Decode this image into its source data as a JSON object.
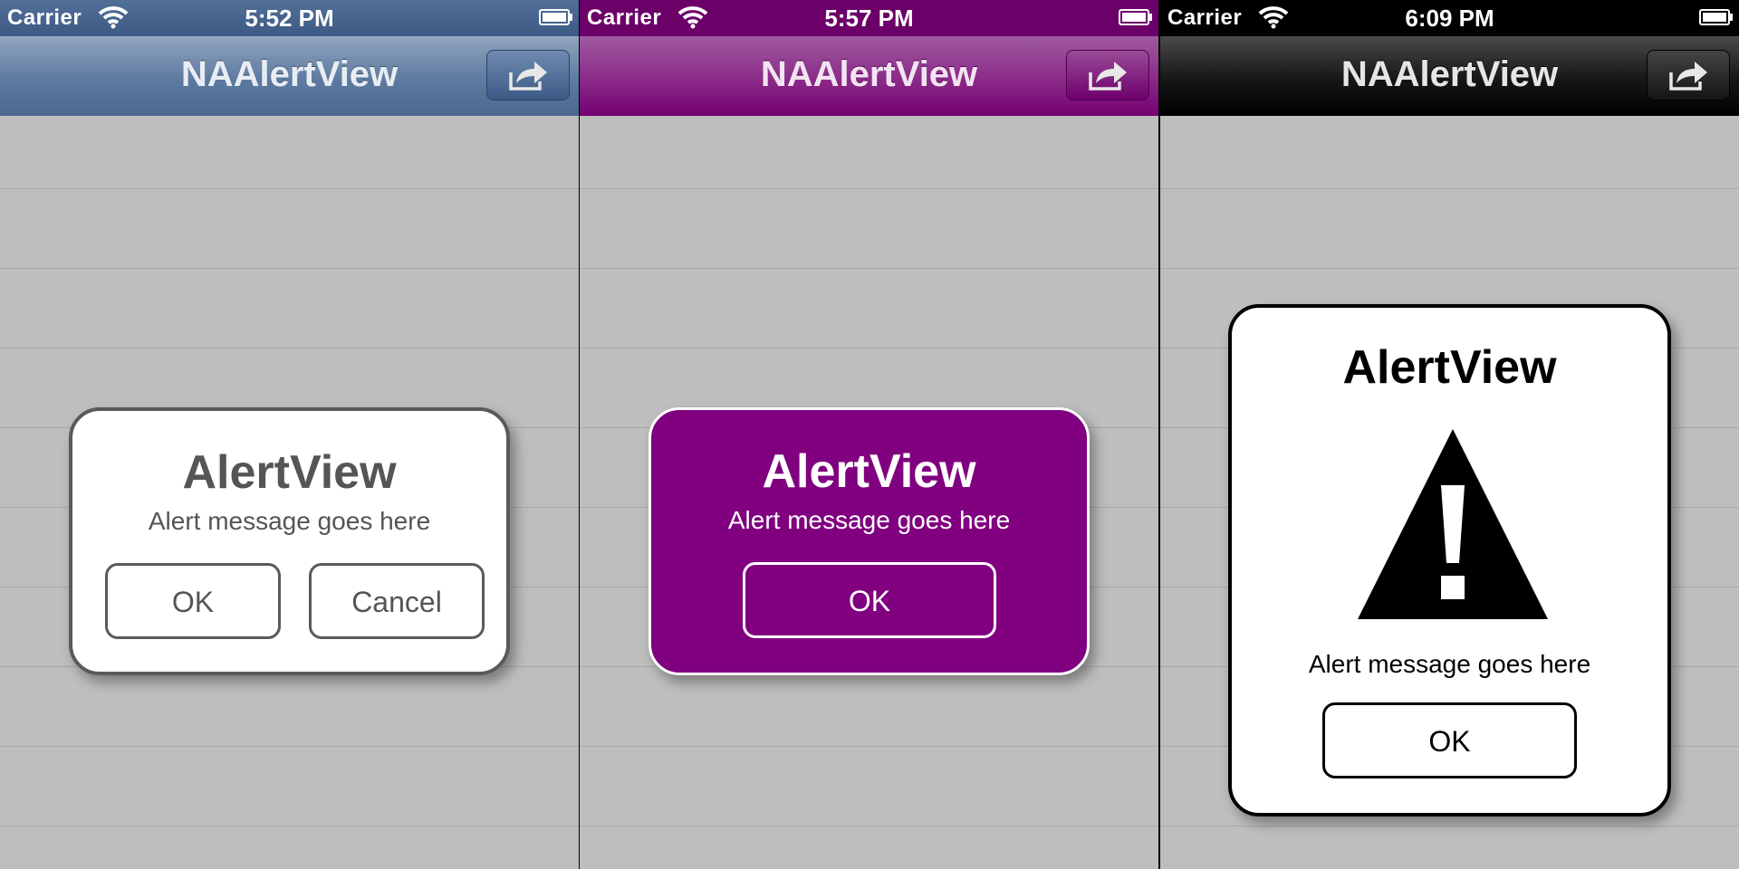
{
  "screens": [
    {
      "theme": "blue",
      "status": {
        "carrier": "Carrier",
        "time": "5:52 PM"
      },
      "nav": {
        "title": "NAAlertView",
        "share_icon": "share-icon"
      },
      "alert": {
        "title": "AlertView",
        "message": "Alert message goes here",
        "buttons": [
          "OK",
          "Cancel"
        ],
        "background": "#ffffff",
        "border": "#5a5a5a",
        "text_color": "#555555"
      }
    },
    {
      "theme": "purple",
      "status": {
        "carrier": "Carrier",
        "time": "5:57 PM"
      },
      "nav": {
        "title": "NAAlertView",
        "share_icon": "share-icon"
      },
      "alert": {
        "title": "AlertView",
        "message": "Alert message goes here",
        "buttons": [
          "OK"
        ],
        "background": "#800080",
        "border": "#ffffff",
        "text_color": "#ffffff"
      }
    },
    {
      "theme": "black",
      "status": {
        "carrier": "Carrier",
        "time": "6:09 PM"
      },
      "nav": {
        "title": "NAAlertView",
        "share_icon": "share-icon"
      },
      "alert": {
        "title": "AlertView",
        "icon": "warning-icon",
        "message": "Alert message goes here",
        "buttons": [
          "OK"
        ],
        "background": "#ffffff",
        "border": "#000000",
        "text_color": "#000000"
      }
    }
  ]
}
